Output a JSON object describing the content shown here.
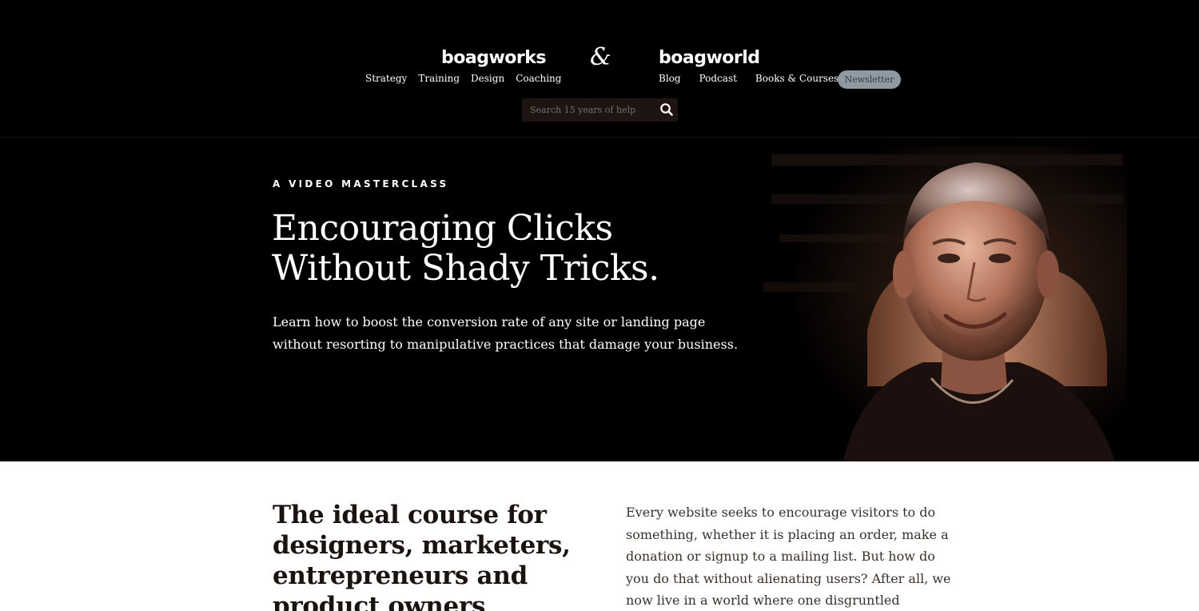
{
  "header": {
    "brand_left": "boagworks",
    "ampersand": "&",
    "brand_right": "boagworld",
    "nav_left": [
      {
        "label": "Strategy"
      },
      {
        "label": "Training"
      },
      {
        "label": "Design"
      },
      {
        "label": "Coaching"
      }
    ],
    "nav_right": [
      {
        "label": "Blog"
      },
      {
        "label": "Podcast"
      },
      {
        "label": "Books & Courses"
      }
    ],
    "newsletter_label": "Newsletter",
    "search": {
      "placeholder": "Search 15 years of help",
      "icon": "search-icon"
    }
  },
  "hero": {
    "eyebrow": "A VIDEO MASTERCLASS",
    "title_line1": "Encouraging Clicks",
    "title_line2": "Without Shady Tricks.",
    "subtitle": "Learn how to boost the conversion rate of any site or landing page without resorting to manipulative practices that damage your business.",
    "portrait_alt": "portrait-photo"
  },
  "content": {
    "heading": "The ideal course for designers, marketers, entrepreneurs and product owners",
    "intro": "Every website seeks to encourage visitors to do something, whether it is placing an order, make a donation or signup to a mailing list. But how do you do that without alienating users? After all, we now live in a world where one disgruntled customer can"
  },
  "colors": {
    "background": "#000000",
    "newsletter_button": "#8d9aa1",
    "search_bg": "#1e1412",
    "content_bg": "#ffffff",
    "heading_text": "#1a1311"
  }
}
